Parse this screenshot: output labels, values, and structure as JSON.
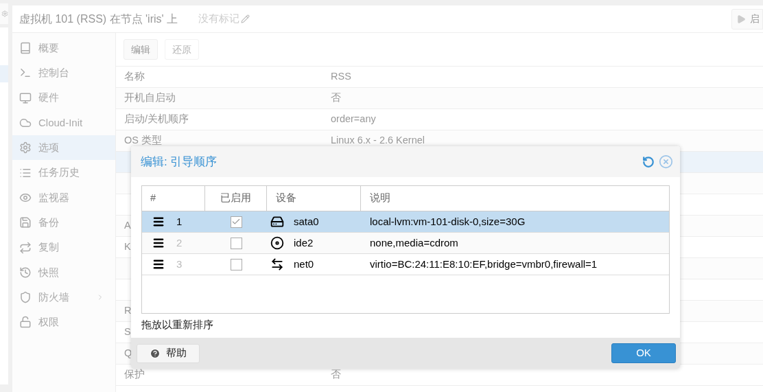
{
  "header": {
    "title": "虚拟机 101 (RSS) 在节点 'iris' 上",
    "tags": "没有标记",
    "start_button": "启"
  },
  "sidebar": {
    "items": [
      {
        "label": "概要",
        "selected": false
      },
      {
        "label": "控制台",
        "selected": false
      },
      {
        "label": "硬件",
        "selected": false
      },
      {
        "label": "Cloud-Init",
        "selected": false
      },
      {
        "label": "选项",
        "selected": true
      },
      {
        "label": "任务历史",
        "selected": false
      },
      {
        "label": "监视器",
        "selected": false
      },
      {
        "label": "备份",
        "selected": false
      },
      {
        "label": "复制",
        "selected": false
      },
      {
        "label": "快照",
        "selected": false
      },
      {
        "label": "防火墙",
        "selected": false,
        "expandable": true
      },
      {
        "label": "权限",
        "selected": false,
        "expandable": false
      }
    ]
  },
  "toolbar": {
    "buttons": [
      {
        "label": "编辑",
        "disabled": false
      },
      {
        "label": "还原",
        "disabled": true
      }
    ]
  },
  "options": {
    "rows": [
      {
        "label": "名称",
        "value": "RSS",
        "selected": false
      },
      {
        "label": "开机自启动",
        "value": "否",
        "selected": false
      },
      {
        "label": "启动/关机顺序",
        "value": "order=any",
        "selected": false
      },
      {
        "label": "OS 类型",
        "value": "Linux 6.x - 2.6 Kernel",
        "selected": false
      },
      {
        "selected": true
      },
      {
        "selected": false
      },
      {
        "selected": false
      },
      {
        "label": "A",
        "selected": false
      },
      {
        "label": "K",
        "selected": false
      },
      {
        "selected": false
      },
      {
        "selected": false
      },
      {
        "label": "R",
        "selected": false
      },
      {
        "label": "S",
        "selected": false
      },
      {
        "label": "Q",
        "selected": false
      },
      {
        "label": "保护",
        "value": "否",
        "selected": false
      }
    ]
  },
  "dialog": {
    "title": "编辑: 引导顺序",
    "columns": [
      "#",
      "已启用",
      "设备",
      "说明"
    ],
    "rows": [
      {
        "index": "1",
        "enabled": true,
        "device": "sata0",
        "description": "local-lvm:vm-101-disk-0,size=30G",
        "selected": true
      },
      {
        "index": "2",
        "enabled": false,
        "device": "ide2",
        "description": "none,media=cdrom",
        "selected": false
      },
      {
        "index": "3",
        "enabled": false,
        "device": "net0",
        "description": "virtio=BC:24:11:E8:10:EF,bridge=vmbr0,firewall=1",
        "selected": false
      }
    ],
    "hint": "拖放以重新排序",
    "help_button": "帮助",
    "ok_button": "OK"
  }
}
